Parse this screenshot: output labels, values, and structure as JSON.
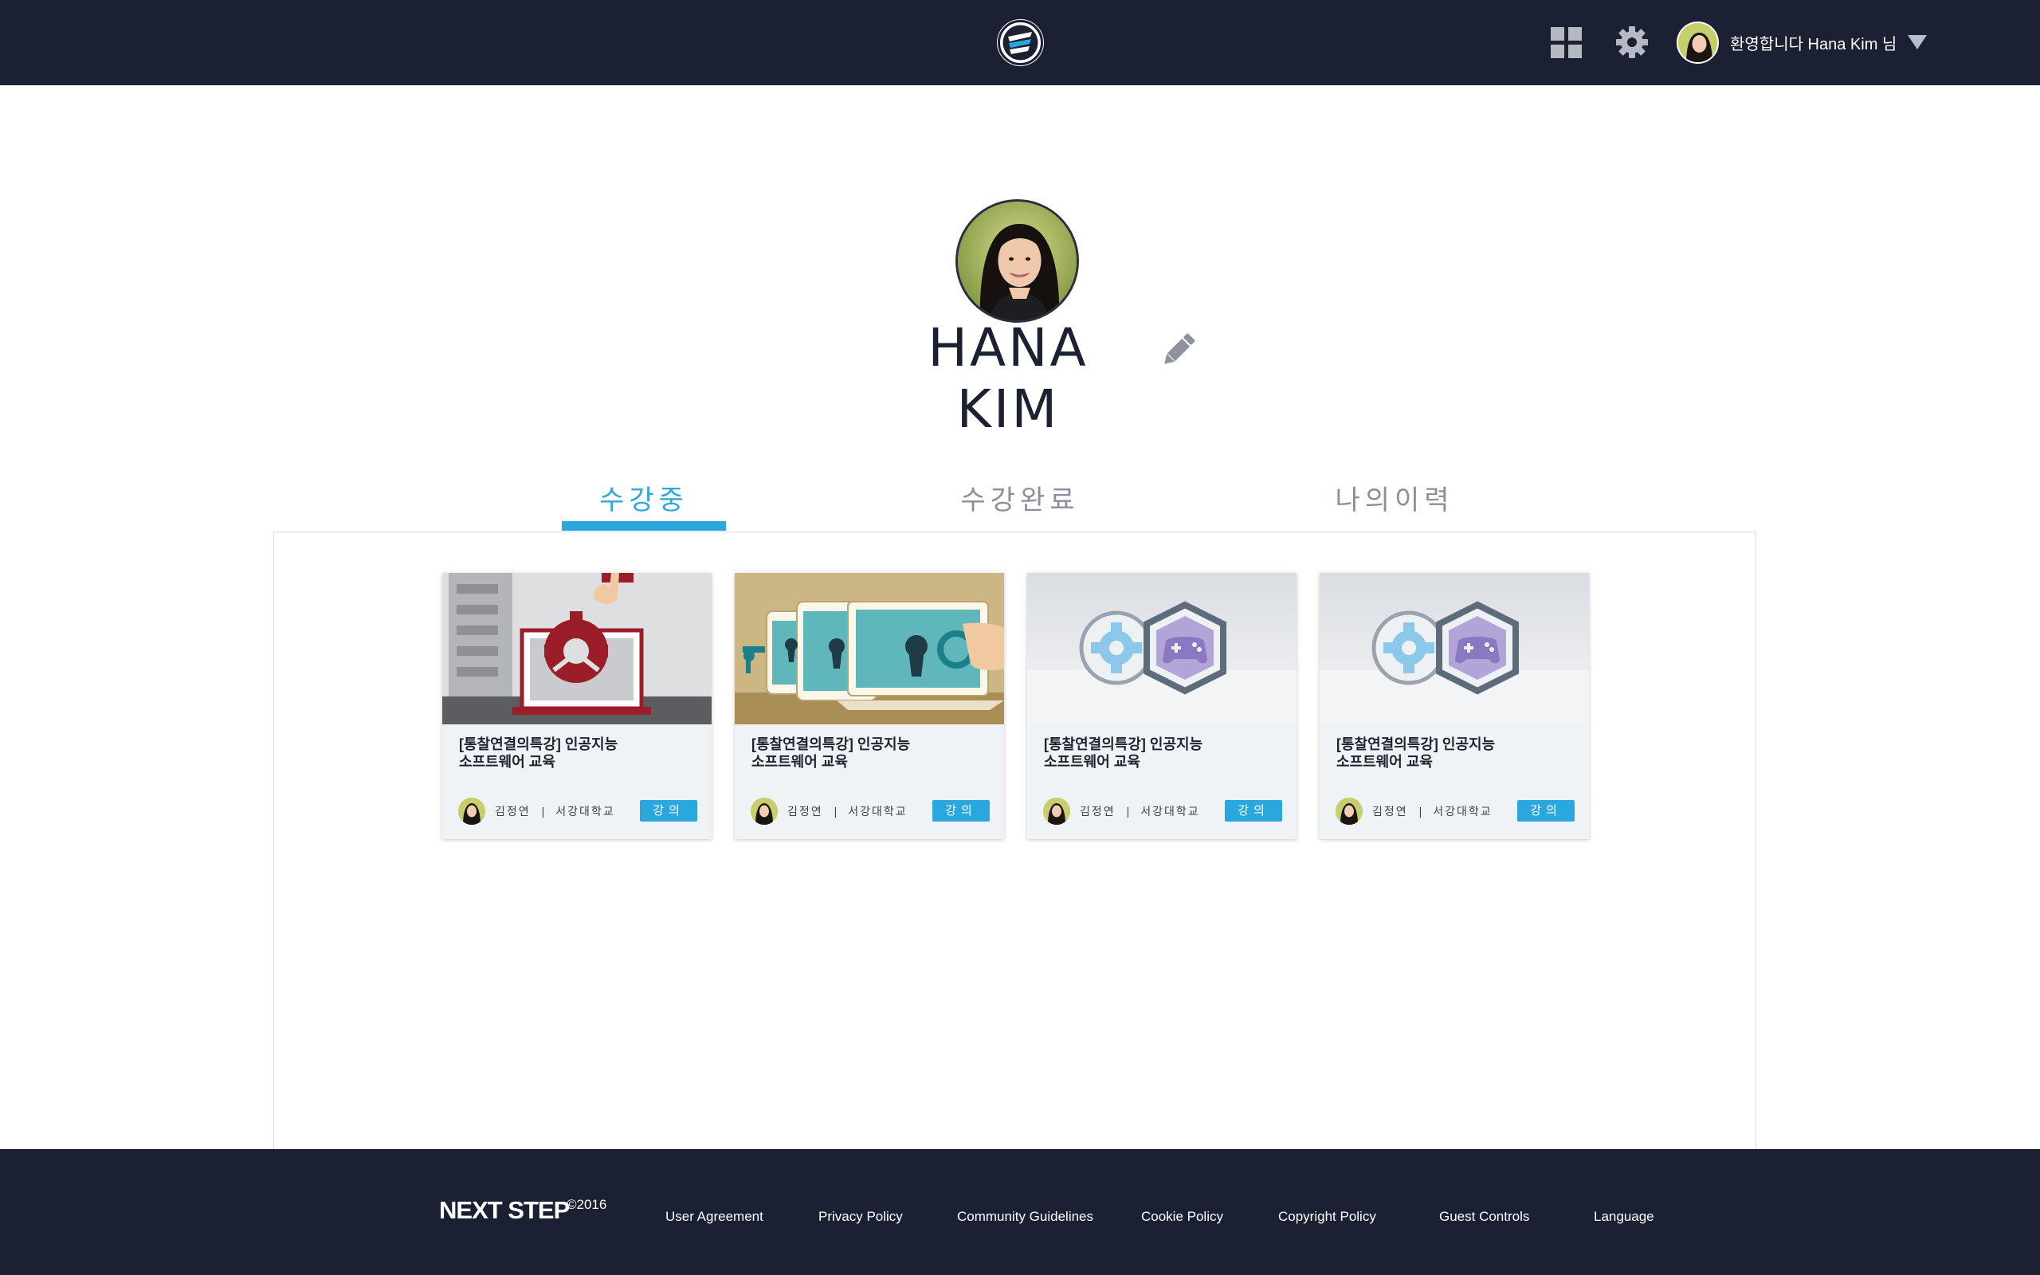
{
  "header": {
    "welcome_text": "환영합니다 Hana Kim 님",
    "icons": [
      "logo-icon",
      "apps-grid-icon",
      "gear-icon",
      "chevron-down-icon"
    ]
  },
  "profile": {
    "name": "HANA KIM"
  },
  "tabs": [
    {
      "label": "수강중",
      "active": true
    },
    {
      "label": "수강완료",
      "active": false
    },
    {
      "label": "나의이력",
      "active": false
    }
  ],
  "courses": [
    {
      "title_line1": "[통찰연결의특강] 인공지능",
      "title_line2": "소프트웨어 교육",
      "instructor": "김정연",
      "separator": "|",
      "school": "서강대학교",
      "badge": "강의"
    },
    {
      "title_line1": "[통찰연결의특강] 인공지능",
      "title_line2": "소프트웨어 교육",
      "instructor": "김정연",
      "separator": "|",
      "school": "서강대학교",
      "badge": "강의"
    },
    {
      "title_line1": "[통찰연결의특강] 인공지능",
      "title_line2": "소프트웨어 교육",
      "instructor": "김정연",
      "separator": "|",
      "school": "서강대학교",
      "badge": "강의"
    },
    {
      "title_line1": "[통찰연결의특강] 인공지능",
      "title_line2": "소프트웨어 교육",
      "instructor": "김정연",
      "separator": "|",
      "school": "서강대학교",
      "badge": "강의"
    }
  ],
  "footer": {
    "brand": "NEXT STEP",
    "year": "©2016",
    "links": [
      "User Agreement",
      "Privacy Policy",
      "Community Guidelines",
      "Cookie Policy",
      "Copyright Policy",
      "Guest Controls",
      "Language"
    ]
  },
  "colors": {
    "nav_bg": "#1b2033",
    "accent": "#2aa7dc",
    "card_bg": "#f0f3f6"
  }
}
